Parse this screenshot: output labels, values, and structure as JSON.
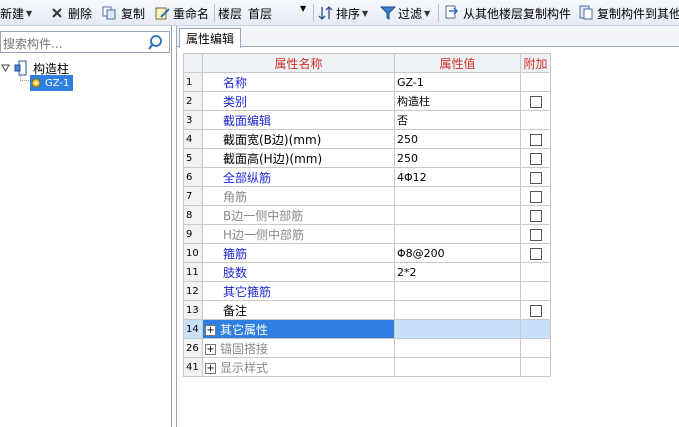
{
  "toolbar": {
    "new_label": "新建",
    "delete_label": "删除",
    "copy_label": "复制",
    "rename_label": "重命名",
    "floor_label": "楼层",
    "floor_value": "首层",
    "sort_label": "排序",
    "filter_label": "过滤",
    "copy_from_floor_label": "从其他楼层复制构件",
    "copy_to_floor_label": "复制构件到其他"
  },
  "search": {
    "placeholder": "搜索构件..."
  },
  "tree": {
    "root_label": "构造柱",
    "child_label": "GZ-1"
  },
  "tabs": [
    {
      "label": "属性编辑"
    }
  ],
  "table": {
    "headers": {
      "name": "属性名称",
      "value": "属性值",
      "extra": "附加"
    },
    "rows": [
      {
        "num": "1",
        "name": "名称",
        "value": "GZ-1",
        "color": "blue",
        "checkbox": false
      },
      {
        "num": "2",
        "name": "类别",
        "value": "构造柱",
        "color": "blue",
        "checkbox": true
      },
      {
        "num": "3",
        "name": "截面编辑",
        "value": "否",
        "color": "blue",
        "checkbox": false
      },
      {
        "num": "4",
        "name": "截面宽(B边)(mm)",
        "value": "250",
        "color": "black",
        "checkbox": true
      },
      {
        "num": "5",
        "name": "截面高(H边)(mm)",
        "value": "250",
        "color": "black",
        "checkbox": true
      },
      {
        "num": "6",
        "name": "全部纵筋",
        "value": "4Φ12",
        "color": "blue",
        "checkbox": true
      },
      {
        "num": "7",
        "name": "角筋",
        "value": "",
        "color": "gray",
        "checkbox": true
      },
      {
        "num": "8",
        "name": "B边一侧中部筋",
        "value": "",
        "color": "gray",
        "checkbox": true
      },
      {
        "num": "9",
        "name": "H边一侧中部筋",
        "value": "",
        "color": "gray",
        "checkbox": true
      },
      {
        "num": "10",
        "name": "箍筋",
        "value": "Φ8@200",
        "color": "blue",
        "checkbox": true
      },
      {
        "num": "11",
        "name": "肢数",
        "value": "2*2",
        "color": "blue",
        "checkbox": false
      },
      {
        "num": "12",
        "name": "其它箍筋",
        "value": "",
        "color": "blue",
        "checkbox": false
      },
      {
        "num": "13",
        "name": "备注",
        "value": "",
        "color": "black",
        "checkbox": true
      },
      {
        "num": "14",
        "name": "其它属性",
        "value": "",
        "color": "white",
        "checkbox": false,
        "expander": "+",
        "selected": true
      },
      {
        "num": "26",
        "name": "锚固搭接",
        "value": "",
        "color": "gray",
        "checkbox": false,
        "expander": "+"
      },
      {
        "num": "41",
        "name": "显示样式",
        "value": "",
        "color": "gray",
        "checkbox": false,
        "expander": "+"
      }
    ]
  },
  "colors": {
    "header_text": "#d12f22",
    "blue_text": "#1f27d6",
    "gray_text": "#8a8a8a",
    "selection": "#2f7fe0"
  }
}
